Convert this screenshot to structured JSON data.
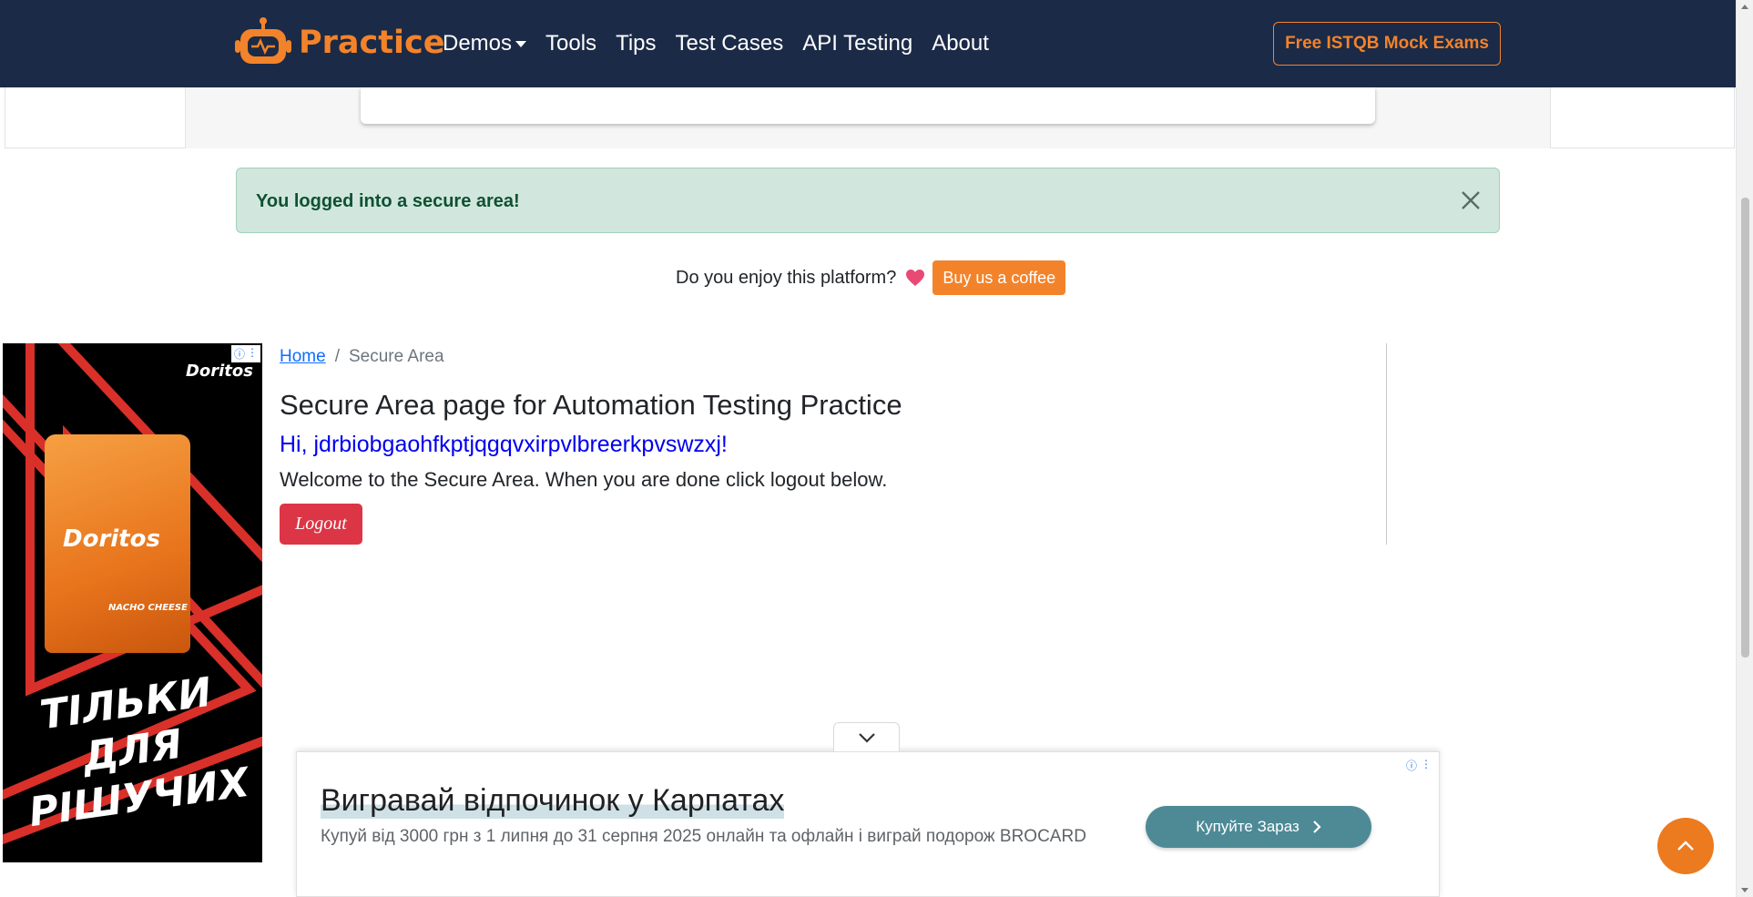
{
  "navbar": {
    "brand": "Practice",
    "links": [
      {
        "label": "Demos",
        "has_dropdown": true
      },
      {
        "label": "Tools"
      },
      {
        "label": "Tips"
      },
      {
        "label": "Test Cases"
      },
      {
        "label": "API Testing"
      },
      {
        "label": "About"
      }
    ],
    "cta_label": "Free ISTQB Mock Exams"
  },
  "alert": {
    "message": "You logged into a secure area!"
  },
  "coffee": {
    "text": "Do you enjoy this platform?",
    "button_label": "Buy us a coffee"
  },
  "breadcrumb": {
    "home": "Home",
    "separator": "/",
    "current": "Secure Area"
  },
  "main": {
    "title": "Secure Area page for Automation Testing Practice",
    "greeting": "Hi, jdrbiobgaohfkptjqgqvxirpvlbreerkpvswzxj!",
    "welcome": "Welcome to the Secure Area. When you are done click logout below.",
    "logout_label": "Logout"
  },
  "left_ad": {
    "brand": "Doritos",
    "bag_sub": "NACHO CHEESE",
    "slogan_lines": [
      "ТІЛЬКИ",
      "ДЛЯ",
      "РІШУЧИХ"
    ]
  },
  "bottom_ad": {
    "title": "Вигравай відпочинок у Карпатах",
    "description": "Купуй від 3000 грн з 1 липня до 31 серпня 2025 онлайн та офлайн і виграй подорож BROCARD",
    "button_label": "Купуйте Зараз"
  },
  "colors": {
    "navbar_bg": "#1b2a47",
    "accent_orange": "#f3832a",
    "alert_bg": "#d1e7dd",
    "alert_text": "#0f5132",
    "danger": "#dc3545",
    "link_blue": "#0d6efd",
    "ad_button_teal": "#4d8a96"
  },
  "icons": {
    "brand_logo": "robot-icon",
    "alert_close": "close-icon",
    "heart": "heart-icon",
    "ad_collapse": "chevron-down-icon",
    "ad_cta": "chevron-right-icon",
    "scroll_top": "chevron-up-icon",
    "ad_info": "info-icon",
    "ad_menu": "kebab-icon"
  }
}
